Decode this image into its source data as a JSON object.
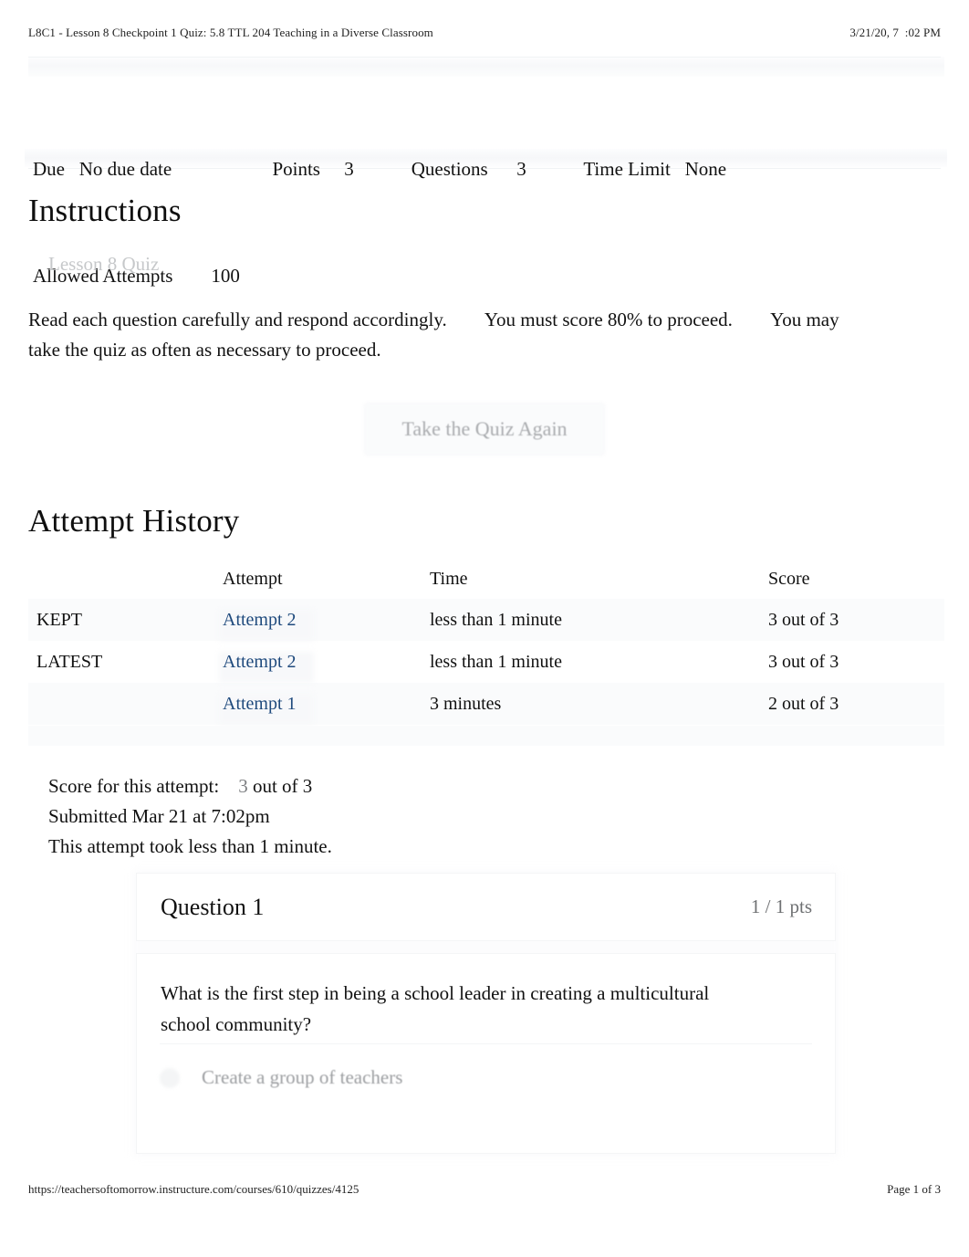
{
  "print_header": {
    "title": "L8C1 - Lesson 8 Checkpoint 1 Quiz: 5.8 TTL 204 Teaching in a Diverse Classroom",
    "timestamp": "3/21/20, 7  :02 PM"
  },
  "quiz_meta": {
    "due_label": "Due",
    "due_value": "No due date",
    "points_label": "Points",
    "points_value": "3",
    "questions_label": "Questions",
    "questions_value": "3",
    "time_limit_label": "Time Limit",
    "time_limit_value": "None",
    "allowed_attempts_label": "Allowed Attempts",
    "allowed_attempts_value": "100",
    "line1": "Due   No due date                     Points     3            Questions      3            Time Limit   None",
    "line2": "Allowed Attempts        100"
  },
  "instructions": {
    "heading": "Instructions",
    "subheading": "Lesson 8 Quiz",
    "body": "Read each question carefully and respond accordingly.        You must score 80% to proceed.        You may\ntake the quiz as often as necessary to proceed."
  },
  "retake_button": {
    "label": "Take the Quiz Again"
  },
  "attempt_history": {
    "heading": "Attempt History",
    "columns": [
      "",
      "Attempt",
      "Time",
      "Score"
    ],
    "rows": [
      {
        "tag": "KEPT",
        "attempt": "Attempt 2",
        "time": "less than 1 minute",
        "score": "3 out of 3"
      },
      {
        "tag": "LATEST",
        "attempt": "Attempt 2",
        "time": "less than 1 minute",
        "score": "3 out of 3"
      },
      {
        "tag": "",
        "attempt": "Attempt 1",
        "time": "3 minutes",
        "score": "2 out of 3"
      }
    ]
  },
  "attempt_summary": {
    "score_label": "Score for this attempt:",
    "score_value": "3",
    "score_suffix": " out of 3",
    "submitted": "Submitted Mar 21 at 7:02pm",
    "duration": "This attempt took less than 1 minute."
  },
  "question": {
    "title": "Question 1",
    "points": "1 / 1 pts",
    "text": "What is the first step in being a school leader in creating a multicultural school community?",
    "answers": [
      {
        "label": "Create a group of teachers",
        "selected": false
      }
    ]
  },
  "print_footer": {
    "url": "https://teachersoftomorrow.instructure.com/courses/610/quizzes/4125",
    "page": "Page 1 of 3"
  },
  "colors": {
    "link": "#1f4a7d",
    "muted": "#7d7f82",
    "faded": "#a9abae",
    "text": "#111111"
  }
}
